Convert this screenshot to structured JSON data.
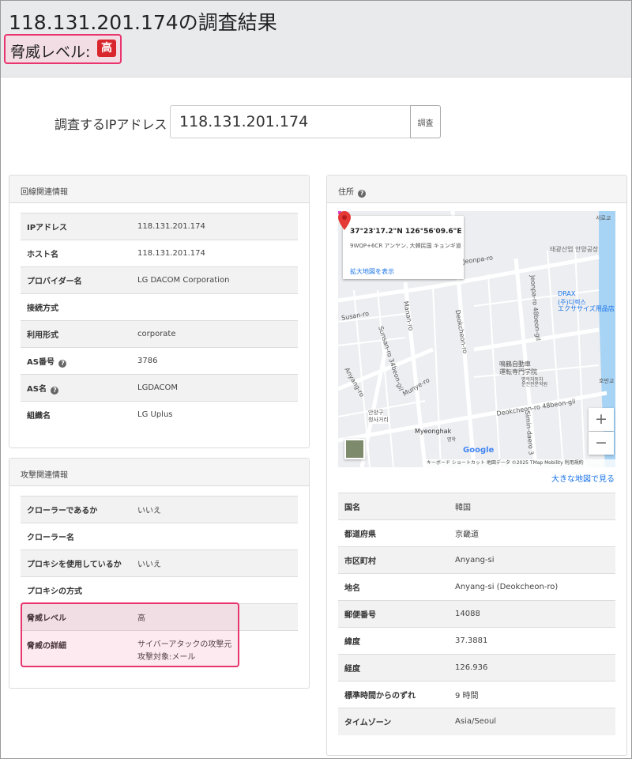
{
  "header": {
    "title": "118.131.201.174の調査結果",
    "threat_label": "脅威レベル:",
    "threat_badge": "高"
  },
  "search": {
    "label": "調査するIPアドレス",
    "value": "118.131.201.174",
    "button": "調査"
  },
  "line_panel": {
    "title": "回線関連情報",
    "rows": [
      {
        "key": "IPアドレス",
        "value": "118.131.201.174"
      },
      {
        "key": "ホスト名",
        "value": "118.131.201.174"
      },
      {
        "key": "プロバイダー名",
        "value": "LG DACOM Corporation"
      },
      {
        "key": "接続方式",
        "value": ""
      },
      {
        "key": "利用形式",
        "value": "corporate"
      },
      {
        "key": "AS番号",
        "value": "3786"
      },
      {
        "key": "AS名",
        "value": "LGDACOM"
      },
      {
        "key": "組織名",
        "value": "LG Uplus"
      }
    ]
  },
  "attack_panel": {
    "title": "攻撃関連情報",
    "rows": [
      {
        "key": "クローラーであるか",
        "value": "いいえ"
      },
      {
        "key": "クローラー名",
        "value": ""
      },
      {
        "key": "プロキシを使用しているか",
        "value": "いいえ"
      },
      {
        "key": "プロキシの方式",
        "value": ""
      },
      {
        "key": "脅威レベル",
        "value": "高"
      },
      {
        "key": "脅威の詳細",
        "value": "サイバーアタックの攻撃元",
        "value2": "攻撃対象:メール"
      }
    ]
  },
  "address_panel": {
    "title": "住所",
    "map": {
      "coords": "37°23'17.2\"N 126°56'09.6\"E",
      "plus_code": "9WQP+6CR アンヤン, 大韓民国 キョンギ道",
      "enlarge_link": "拡大地図を表示",
      "labels": {
        "seorogyo": "서로교",
        "taegwang": "태광산업 안양공장",
        "jeonpa": "Jeonpa-ro",
        "drax": "DRAX",
        "drax2": "(주)디렉스",
        "drax3": "エクササイズ用品店",
        "suan": "Susan-ro",
        "manan": "Manan-ro",
        "deokcheon": "Deokcheon-ro",
        "jeonpa48": "Jeonpa-ro 48beon-gil",
        "school1": "鳴鶴自動車",
        "school2": "運転専門学院",
        "school3": "명학자동차",
        "school4": "운전전문학원",
        "deok48": "Deokcheon-ro 48beon-gil",
        "simin": "Simin-daero 3",
        "anyang": "Anyang-ro",
        "sunsan": "Sunsan-ro 34beon-gil",
        "munye": "Munye-ro",
        "myeonghak": "Myeonghak",
        "myeonghak_kr": "명학",
        "hanangu": "안양구",
        "hanangu2": "청사거리",
        "hoban": "호반교"
      },
      "footer": "キーボード ショートカット   地図データ ©2025 TMap Mobility   利用規約",
      "google": "Google",
      "zoom_in": "+",
      "zoom_out": "−"
    },
    "big_map_link": "大きな地図で見る",
    "rows": [
      {
        "key": "国名",
        "value": "韓国"
      },
      {
        "key": "都道府県",
        "value": "京畿道"
      },
      {
        "key": "市区町村",
        "value": "Anyang-si"
      },
      {
        "key": "地名",
        "value": "Anyang-si (Deokcheon-ro)"
      },
      {
        "key": "郵便番号",
        "value": "14088"
      },
      {
        "key": "緯度",
        "value": "37.3881"
      },
      {
        "key": "経度",
        "value": "126.936"
      },
      {
        "key": "標準時間からのずれ",
        "value": "9 時間"
      },
      {
        "key": "タイムゾーン",
        "value": "Asia/Seoul"
      }
    ]
  }
}
